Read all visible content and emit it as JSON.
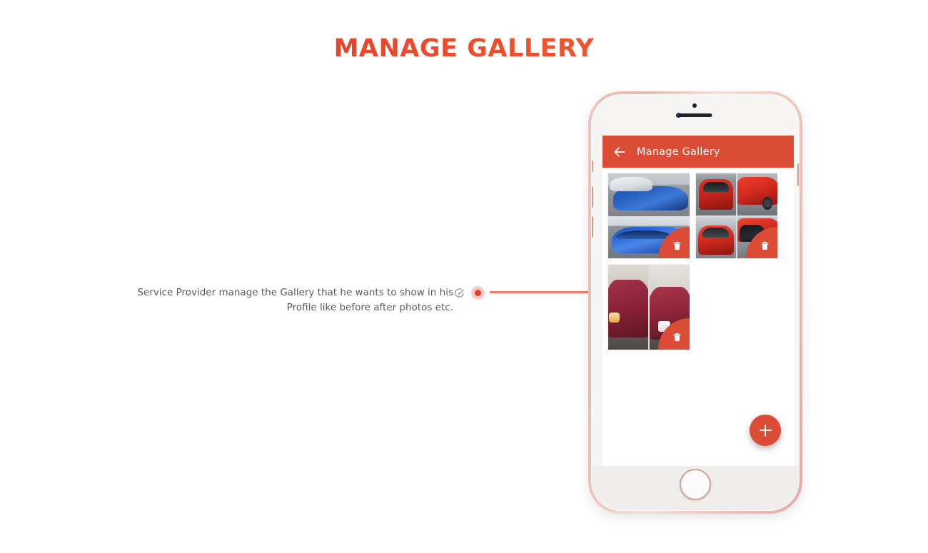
{
  "page": {
    "title": "MANAGE GALLERY"
  },
  "annotation": {
    "text": "Service Provider manage the Gallery that he wants to show in his Profile like before after photos etc.",
    "check_icon": "check-circle-icon",
    "marker_icon": "red-dot-marker",
    "marker_color": "#ea3b23",
    "line_color": "#f37b6e"
  },
  "phone": {
    "frame_color": "#e8b8b1",
    "speaker_icon": "earpiece-speaker",
    "camera_icon": "front-camera",
    "sensor_icon": "proximity-sensor",
    "home_button_icon": "home-button"
  },
  "app": {
    "appbar": {
      "back_icon": "back-arrow-icon",
      "title": "Manage Gallery",
      "background": "#dc4b35"
    },
    "gallery": {
      "delete_icon": "trash-icon",
      "items": [
        {
          "name": "blue-subaru-before-after",
          "layout": "rows2",
          "tiles": [
            "ph-snowlot",
            "ph-bluecar"
          ],
          "delete_label": "Delete"
        },
        {
          "name": "red-ford-before-after",
          "layout": "grid4",
          "tiles": [
            "ph-redrear",
            "ph-redside",
            "ph-redfront",
            "ph-redwin"
          ],
          "delete_label": "Delete"
        },
        {
          "name": "maroon-honda-before-after",
          "layout": "cols2",
          "tiles": [
            "ph-maroonL",
            "ph-maroonR"
          ],
          "delete_label": "Delete"
        }
      ]
    },
    "fab": {
      "icon": "plus-icon",
      "label": "Add photo",
      "color": "#dc4b35"
    }
  }
}
